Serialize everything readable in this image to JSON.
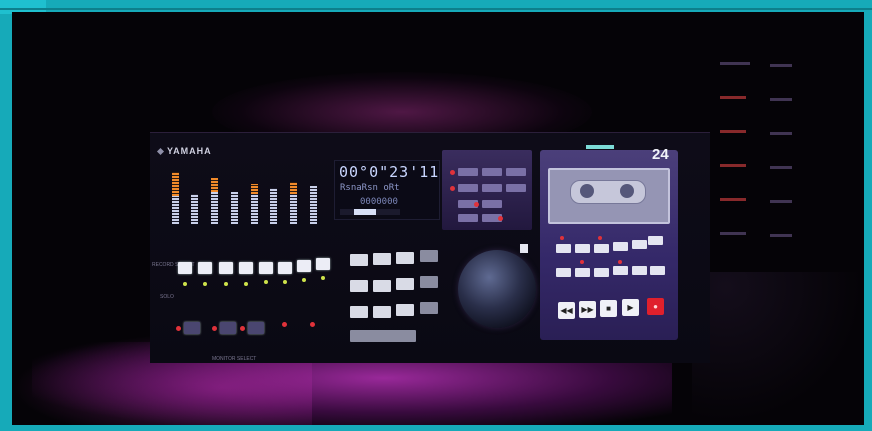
{
  "photo": {
    "brand": "YAMAHA",
    "lcd_time": "00°0\"23'11",
    "lcd_row": "RsnaRsn  oRt",
    "lcd_row2": "0000000",
    "tape_count": "24",
    "labels": {
      "record_select": "RECORD SELECT",
      "solo": "SOLO",
      "monitor_select": "MONITOR SELECT"
    }
  },
  "colors": {
    "frame": "#16aab9",
    "glow": "#be32be",
    "accent_red": "#e0323a",
    "led_green": "#cde24a",
    "meter_orange": "#f08a2a"
  }
}
